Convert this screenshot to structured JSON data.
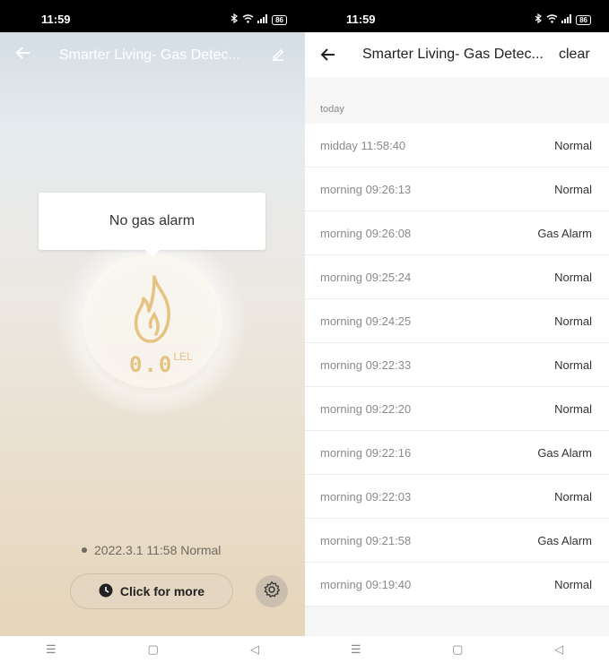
{
  "status_bar": {
    "time": "11:59",
    "battery": "86"
  },
  "left": {
    "title": "Smarter Living- Gas Detec...",
    "tooltip": "No gas alarm",
    "reading": {
      "value": "0.0",
      "unit": "LEL"
    },
    "last_status": "2022.3.1 11:58 Normal",
    "more_button": "Click for more"
  },
  "right": {
    "title": "Smarter Living- Gas Detec...",
    "clear_label": "clear",
    "section_label": "today",
    "records": [
      {
        "time": "midday  11:58:40",
        "status": "Normal"
      },
      {
        "time": "morning  09:26:13",
        "status": "Normal"
      },
      {
        "time": "morning  09:26:08",
        "status": "Gas Alarm"
      },
      {
        "time": "morning  09:25:24",
        "status": "Normal"
      },
      {
        "time": "morning  09:24:25",
        "status": "Normal"
      },
      {
        "time": "morning  09:22:33",
        "status": "Normal"
      },
      {
        "time": "morning  09:22:20",
        "status": "Normal"
      },
      {
        "time": "morning  09:22:16",
        "status": "Gas Alarm"
      },
      {
        "time": "morning  09:22:03",
        "status": "Normal"
      },
      {
        "time": "morning  09:21:58",
        "status": "Gas Alarm"
      },
      {
        "time": "morning  09:19:40",
        "status": "Normal"
      }
    ]
  },
  "icons": [
    "back-arrow-icon",
    "edit-icon",
    "flame-icon",
    "clock-icon",
    "gear-icon",
    "bluetooth-icon",
    "wifi-icon",
    "signal-icon",
    "battery-icon",
    "menu-icon",
    "home-icon",
    "back-icon"
  ],
  "colors": {
    "accent_gold": "#e6c283",
    "status_bar": "#000000"
  }
}
